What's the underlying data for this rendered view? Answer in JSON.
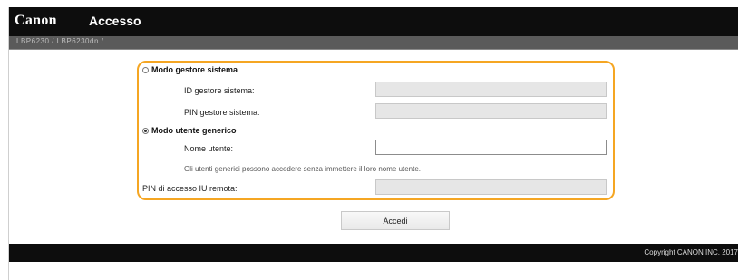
{
  "header": {
    "logo": "Canon",
    "title": "Accesso"
  },
  "breadcrumb": {
    "text": "LBP6230 / LBP6230dn /"
  },
  "form": {
    "system_manager_mode": {
      "label": "Modo gestore sistema",
      "selected": false,
      "id_label": "ID gestore sistema:",
      "id_value": "",
      "pin_label": "PIN gestore sistema:",
      "pin_value": ""
    },
    "general_user_mode": {
      "label": "Modo utente generico",
      "selected": true,
      "username_label": "Nome utente:",
      "username_value": "",
      "hint": "Gli utenti generici possono accedere senza immettere il loro nome utente."
    },
    "remote_ui_pin": {
      "label": "PIN di accesso IU remota:",
      "value": ""
    },
    "highlight_color": "#f5a623"
  },
  "actions": {
    "login_label": "Accedi"
  },
  "footer": {
    "copyright": "Copyright CANON INC. 2017"
  }
}
